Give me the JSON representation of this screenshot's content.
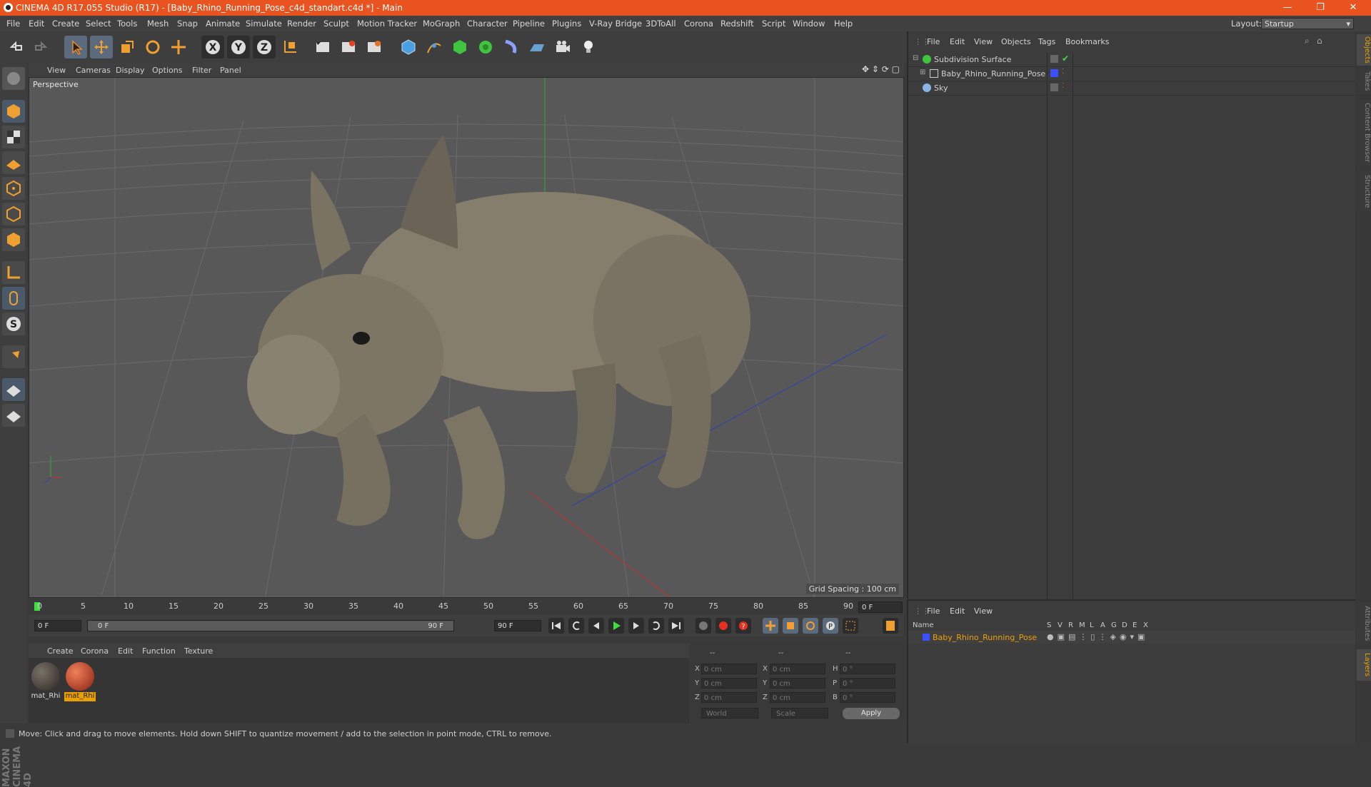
{
  "window": {
    "title": "CINEMA 4D R17.055 Studio (R17) - [Baby_Rhino_Running_Pose_c4d_standart.c4d *] - Main",
    "minimize": "—",
    "maximize": "❐",
    "close": "✕"
  },
  "menubar": {
    "items": [
      "File",
      "Edit",
      "Create",
      "Select",
      "Tools",
      "Mesh",
      "Snap",
      "Animate",
      "Simulate",
      "Render",
      "Sculpt",
      "Motion Tracker",
      "MoGraph",
      "Character",
      "Pipeline",
      "Plugins",
      "V-Ray Bridge",
      "3DToAll",
      "Corona",
      "Redshift",
      "Script",
      "Window",
      "Help"
    ],
    "layout_label": "Layout:",
    "layout_value": "Startup"
  },
  "viewport": {
    "menu": [
      "View",
      "Cameras",
      "Display",
      "Options",
      "Filter",
      "Panel"
    ],
    "label": "Perspective",
    "grid_spacing": "Grid Spacing : 100 cm"
  },
  "timeline": {
    "ticks": [
      "0",
      "5",
      "10",
      "15",
      "20",
      "25",
      "30",
      "35",
      "40",
      "45",
      "50",
      "55",
      "60",
      "65",
      "70",
      "75",
      "80",
      "85",
      "90"
    ],
    "current_frame": "0 F",
    "start_field": "0 F",
    "range_start": "0 F",
    "range_end": "90 F",
    "end_field": "90 F"
  },
  "material_manager": {
    "menu": [
      "Create",
      "Corona",
      "Edit",
      "Function",
      "Texture"
    ],
    "materials": [
      {
        "name": "mat_Rhi",
        "color": "#4a4540",
        "selected": false
      },
      {
        "name": "mat_Rhi",
        "color": "#c8452a",
        "selected": true
      }
    ]
  },
  "coordinates": {
    "header": [
      "--",
      "--",
      "--"
    ],
    "rows": [
      {
        "pos_label": "X",
        "pos": "0 cm",
        "size_label": "X",
        "size": "0 cm",
        "rot_label": "H",
        "rot": "0 °"
      },
      {
        "pos_label": "Y",
        "pos": "0 cm",
        "size_label": "Y",
        "size": "0 cm",
        "rot_label": "P",
        "rot": "0 °"
      },
      {
        "pos_label": "Z",
        "pos": "0 cm",
        "size_label": "Z",
        "size": "0 cm",
        "rot_label": "B",
        "rot": "0 °"
      }
    ],
    "mode_select": "World",
    "size_select": "Scale",
    "apply": "Apply"
  },
  "status": "Move: Click and drag to move elements. Hold down SHIFT to quantize movement / add to the selection in point mode, CTRL to remove.",
  "object_manager": {
    "menu": [
      "File",
      "Edit",
      "View",
      "Objects",
      "Tags",
      "Bookmarks"
    ],
    "objects": [
      {
        "name": "Subdivision Surface",
        "indent": 0,
        "icon_color": "#3fc43f"
      },
      {
        "name": "Baby_Rhino_Running_Pose",
        "indent": 1,
        "icon_color": "#cccccc"
      },
      {
        "name": "Sky",
        "indent": 0,
        "icon_color": "#8ab4e8"
      }
    ]
  },
  "layer_manager": {
    "menu": [
      "File",
      "Edit",
      "View"
    ],
    "columns": [
      "Name",
      "S",
      "V",
      "R",
      "M",
      "L",
      "A",
      "G",
      "D",
      "E",
      "X"
    ],
    "layers": [
      {
        "name": "Baby_Rhino_Running_Pose",
        "color": "#3a50ff"
      }
    ]
  },
  "side_tabs": [
    "Objects",
    "Takes",
    "Content Browser",
    "Structure"
  ],
  "side_tabs_bottom": [
    "Attributes",
    "Layers"
  ],
  "maxon_logo": "MAXON CINEMA 4D"
}
